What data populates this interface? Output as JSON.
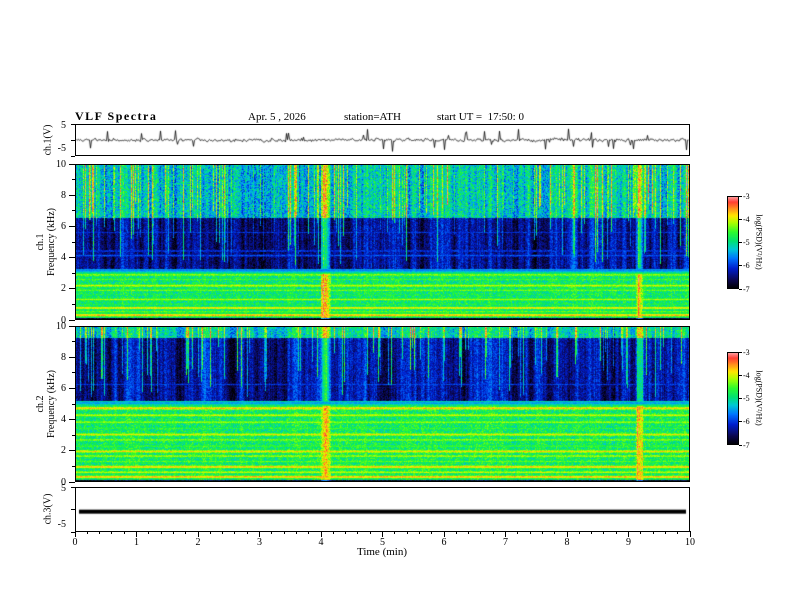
{
  "header": {
    "title": "VLF Spectra",
    "date": "Apr. 5 , 2026",
    "station": "station=ATH",
    "start_ut": "start UT =  17:50: 0"
  },
  "xaxis": {
    "label": "Time (min)",
    "range": [
      0,
      10
    ],
    "ticks": [
      0,
      1,
      2,
      3,
      4,
      5,
      6,
      7,
      8,
      9,
      10
    ],
    "minor_step": 0.2
  },
  "colorbar": {
    "label": "log(PSD)(V²/Hz)",
    "ticks": [
      -3,
      -4,
      -5,
      -6,
      -7
    ],
    "range": [
      -7,
      -3
    ]
  },
  "chart_data": [
    {
      "id": "ch1_wave",
      "type": "line",
      "ylabel": "ch.1(V)",
      "ylim": [
        -5,
        5
      ],
      "ytick_labels": [
        5,
        -5
      ],
      "yticks": [
        5,
        0,
        -5
      ],
      "series_desc": "broadband noise around 0 V, ~±1 V, with sporadic impulsive spikes to about ±4 V over 0-10 min",
      "synthesis": {
        "seed": 5,
        "noise_amp": 0.55,
        "spike_prob": 0.05,
        "spike_amp": 2.8
      }
    },
    {
      "id": "ch1_spectrogram",
      "type": "heatmap",
      "ylabel_lines": [
        "ch.1",
        "Frequency (kHz)"
      ],
      "ylim": [
        0,
        10
      ],
      "xlim": [
        0,
        10
      ],
      "ytick_labels": [
        0,
        2,
        4,
        6,
        8,
        10
      ],
      "zlabel": "log(PSD)(V²/Hz)",
      "zlim": [
        -7,
        -3
      ],
      "summary": "green background below ~3.3 kHz with intense red/orange horizontal lines; dark blue quiet band ~3.3-6.6 kHz crossed by bright vertical sferic streaks; green/yellow speckle above 6.6 kHz",
      "synthesis": {
        "seed": 11,
        "bands": [
          {
            "f": [
              0,
              0.12
            ],
            "base": -6.8,
            "noise": 0.25
          },
          {
            "f": [
              0.12,
              3.3
            ],
            "base": -4.85,
            "noise": 0.45
          },
          {
            "f": [
              3.3,
              6.6
            ],
            "base": -6.35,
            "noise": 0.3
          },
          {
            "f": [
              6.6,
              10
            ],
            "base": -5.2,
            "noise": 0.55
          }
        ],
        "lines": [
          {
            "f": 0.28,
            "level": -3.6,
            "w": 0.08
          },
          {
            "f": 0.5,
            "level": -4.3,
            "w": 0.07
          },
          {
            "f": 0.75,
            "level": -3.8,
            "w": 0.08
          },
          {
            "f": 1.0,
            "level": -4.6,
            "w": 0.07
          },
          {
            "f": 1.3,
            "level": -4.1,
            "w": 0.08
          },
          {
            "f": 1.6,
            "level": -4.7,
            "w": 0.07
          },
          {
            "f": 1.9,
            "level": -4.3,
            "w": 0.08
          },
          {
            "f": 2.2,
            "level": -4.0,
            "w": 0.09
          },
          {
            "f": 2.6,
            "level": -4.5,
            "w": 0.08
          },
          {
            "f": 2.9,
            "level": -4.2,
            "w": 0.09
          },
          {
            "f": 3.2,
            "level": -5.6,
            "w": 0.14,
            "dark": true
          },
          {
            "f": 4.15,
            "level": -5.85,
            "w": 0.09
          },
          {
            "f": 4.45,
            "level": -5.95,
            "w": 0.08
          },
          {
            "f": 5.65,
            "level": -6.05,
            "w": 0.07
          }
        ],
        "streaks": {
          "col_var": 0.55,
          "bright_prob": 0.17,
          "bright_boost": 1.25,
          "min_depth": 3.5,
          "max_depth": 7.5,
          "apply_above": 3.3
        },
        "events": [
          {
            "t": 4.07,
            "w": 0.08,
            "boost": 1.3
          },
          {
            "t": 9.18,
            "w": 0.06,
            "boost": 1.0
          }
        ]
      }
    },
    {
      "id": "ch2_spectrogram",
      "type": "heatmap",
      "ylabel_lines": [
        "ch.2",
        "Frequency (kHz)"
      ],
      "ylim": [
        0,
        10
      ],
      "xlim": [
        0,
        10
      ],
      "ytick_labels": [
        0,
        2,
        4,
        6,
        8,
        10
      ],
      "zlabel": "log(PSD)(V²/Hz)",
      "zlim": [
        -7,
        -3
      ],
      "summary": "green background below ~5.2 kHz with many red/orange horizontal lines up to ~4.8 kHz; dark blue quiet band ~5.2-9.3 kHz crossed by bright vertical sferic streaks; green speckle above 9.3 kHz",
      "synthesis": {
        "seed": 22,
        "bands": [
          {
            "f": [
              0,
              0.12
            ],
            "base": -6.8,
            "noise": 0.25
          },
          {
            "f": [
              0.12,
              5.2
            ],
            "base": -4.8,
            "noise": 0.45
          },
          {
            "f": [
              5.2,
              9.3
            ],
            "base": -6.3,
            "noise": 0.3
          },
          {
            "f": [
              9.3,
              10
            ],
            "base": -5.1,
            "noise": 0.5
          }
        ],
        "lines": [
          {
            "f": 0.3,
            "level": -3.6,
            "w": 0.08
          },
          {
            "f": 0.6,
            "level": -4.0,
            "w": 0.08
          },
          {
            "f": 0.95,
            "level": -3.7,
            "w": 0.09
          },
          {
            "f": 1.3,
            "level": -4.4,
            "w": 0.08
          },
          {
            "f": 1.65,
            "level": -4.1,
            "w": 0.08
          },
          {
            "f": 1.95,
            "level": -3.8,
            "w": 0.09
          },
          {
            "f": 2.3,
            "level": -4.5,
            "w": 0.08
          },
          {
            "f": 2.7,
            "level": -4.2,
            "w": 0.08
          },
          {
            "f": 3.05,
            "level": -3.9,
            "w": 0.09
          },
          {
            "f": 3.45,
            "level": -4.6,
            "w": 0.08
          },
          {
            "f": 3.85,
            "level": -4.2,
            "w": 0.09
          },
          {
            "f": 4.3,
            "level": -4.0,
            "w": 0.09
          },
          {
            "f": 4.75,
            "level": -3.7,
            "w": 0.09
          },
          {
            "f": 5.1,
            "level": -5.5,
            "w": 0.12,
            "dark": true
          },
          {
            "f": 6.3,
            "level": -6.0,
            "w": 0.07
          }
        ],
        "streaks": {
          "col_var": 0.55,
          "bright_prob": 0.15,
          "bright_boost": 1.25,
          "min_depth": 5.5,
          "max_depth": 8.8,
          "apply_above": 5.2
        },
        "events": [
          {
            "t": 4.07,
            "w": 0.08,
            "boost": 1.2
          },
          {
            "t": 9.18,
            "w": 0.06,
            "boost": 0.9
          }
        ]
      }
    },
    {
      "id": "ch3_wave",
      "type": "line",
      "ylabel": "ch.3(V)",
      "ylim": [
        -5,
        5
      ],
      "ytick_labels": [
        5,
        -5
      ],
      "yticks": [
        5,
        0,
        -5
      ],
      "series_desc": "constant flat trace near 0 V (thick black line, no signal)",
      "value": -0.5
    }
  ]
}
